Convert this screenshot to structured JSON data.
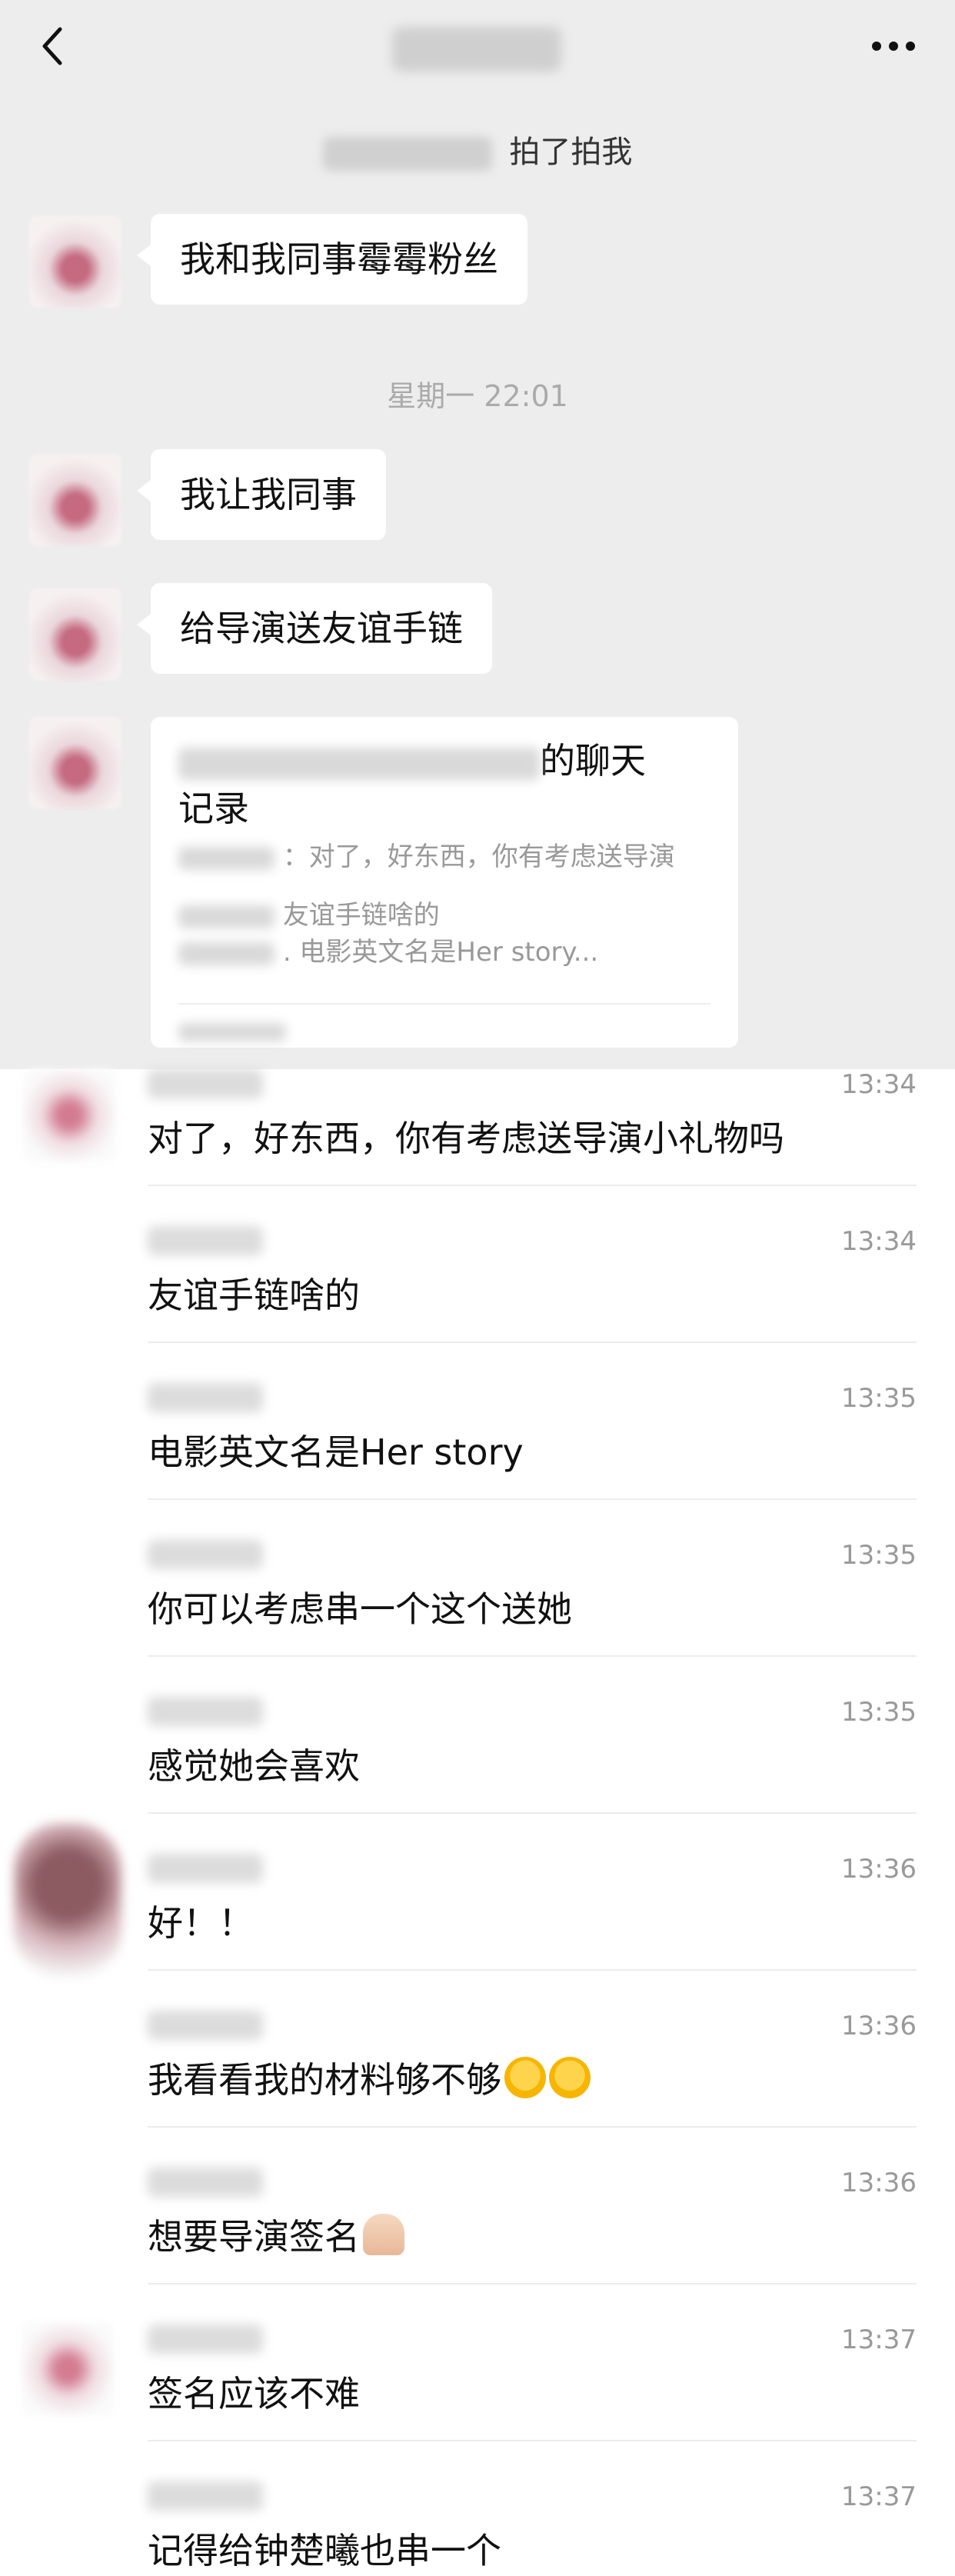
{
  "nav": {
    "title": "",
    "back_icon": "back-icon",
    "more_icon": "more-icon"
  },
  "pat_text": "拍了拍我",
  "top_chat": {
    "bubble1": "我和我同事霉霉粉丝",
    "time": "星期一 22:01",
    "bubble2": "我让我同事",
    "bubble3": "给导演送友谊手链",
    "record_title_suffix": "的聊天",
    "record_title_line2": "记录",
    "record_sub1": "：对了，好东西，你有考虑送导演",
    "record_sub2": "友谊手链啥的",
    "record_sub3": ". 电影英文名是Her story..."
  },
  "messages": [
    {
      "time": "13:34",
      "text": "对了，好东西，你有考虑送导演小礼物吗"
    },
    {
      "time": "13:34",
      "text": "友谊手链啥的"
    },
    {
      "time": "13:35",
      "text": "电影英文名是Her story"
    },
    {
      "time": "13:35",
      "text": "你可以考虑串一个这个送她"
    },
    {
      "time": "13:35",
      "text": "感觉她会喜欢"
    },
    {
      "time": "13:36",
      "text": "好！！"
    },
    {
      "time": "13:36",
      "text": "我看看我的材料够不够"
    },
    {
      "time": "13:36",
      "text": "想要导演签名"
    },
    {
      "time": "13:37",
      "text": "签名应该不难"
    },
    {
      "time": "13:37",
      "text": "记得给钟楚曦也串一个"
    }
  ],
  "colors": {
    "chat_bg": "#ededed",
    "bubble": "#ffffff",
    "meta": "#999999"
  }
}
